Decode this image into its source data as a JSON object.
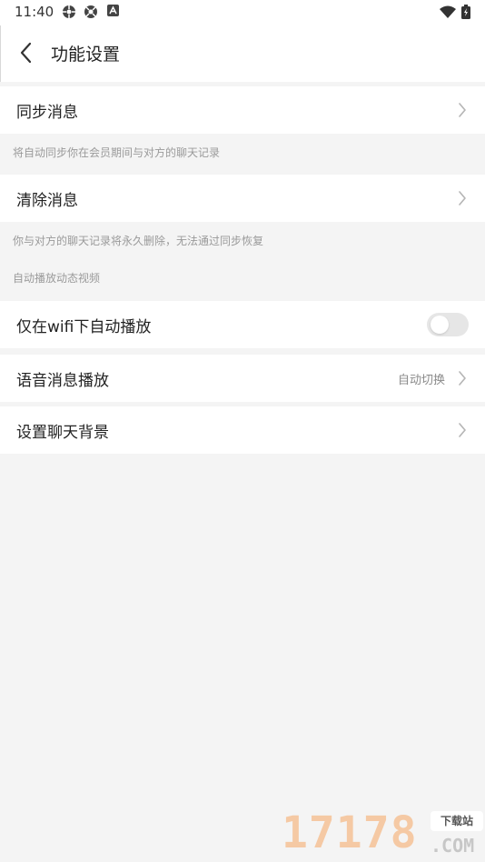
{
  "status_bar": {
    "time": "11:40",
    "icons": [
      "app-icon-1",
      "app-icon-2",
      "accessibility-icon"
    ],
    "right_icons": [
      "wifi-icon",
      "battery-icon"
    ]
  },
  "header": {
    "title": "功能设置",
    "back_icon": "chevron-left-icon"
  },
  "settings": {
    "sync": {
      "label": "同步消息",
      "hint": "将自动同步你在会员期间与对方的聊天记录"
    },
    "clear": {
      "label": "清除消息",
      "hint": "你与对方的聊天记录将永久删除，无法通过同步恢复"
    },
    "autoplay_section": "自动播放动态视频",
    "wifi_autoplay": {
      "label": "仅在wifi下自动播放",
      "enabled": false
    },
    "voice_playback": {
      "label": "语音消息播放",
      "value": "自动切换"
    },
    "chat_background": {
      "label": "设置聊天背景"
    }
  },
  "watermark": {
    "number": "17178",
    "badge": "下载站",
    "domain": ".COM"
  },
  "colors": {
    "background": "#f4f4f4",
    "card": "#ffffff",
    "hint_text": "#9a9a9a",
    "toggle_off": "#e6e6e6"
  }
}
